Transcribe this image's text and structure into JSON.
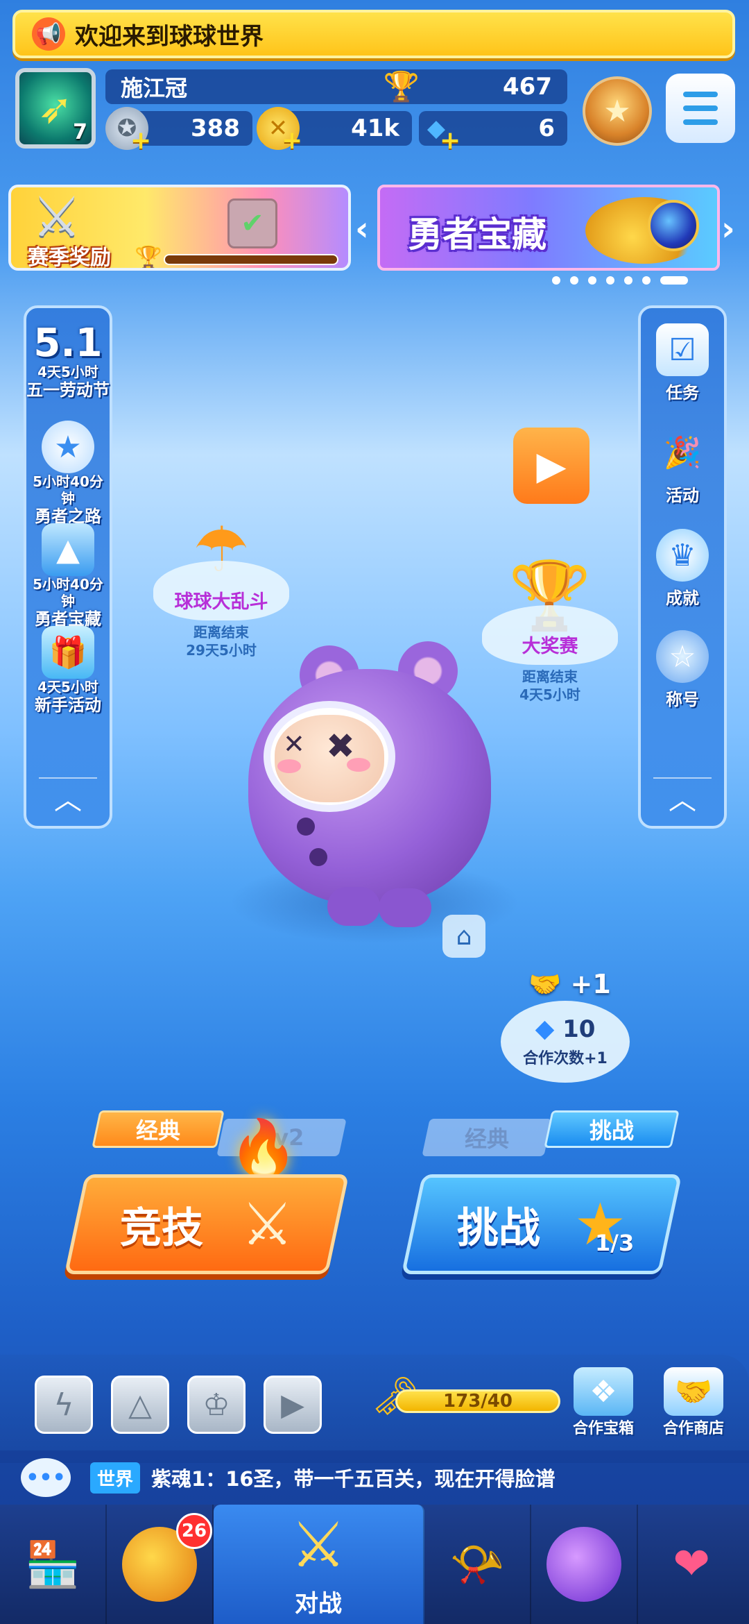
{
  "announcement": {
    "icon": "megaphone-icon",
    "text": "欢迎来到球球世界"
  },
  "player": {
    "name": "施江冠",
    "level": "7",
    "trophy_score": "467",
    "avatar_icon": "bow-emblem-icon"
  },
  "resources": [
    {
      "name": "stars",
      "icon": "star-coin-icon",
      "value": "388"
    },
    {
      "name": "coins",
      "icon": "gold-coin-icon",
      "value": "41k"
    },
    {
      "name": "diamonds",
      "icon": "diamond-icon",
      "value": "6"
    }
  ],
  "season_reward": {
    "label": "赛季奖励"
  },
  "promo": {
    "title": "勇者宝藏",
    "slides": 7,
    "active_slide": 7
  },
  "left_panel": [
    {
      "big": "5.1",
      "timer": "4天5小时",
      "label": "五一劳动节"
    },
    {
      "timer": "5小时40分钟",
      "label": "勇者之路"
    },
    {
      "timer": "5小时40分钟",
      "label": "勇者宝藏"
    },
    {
      "timer": "4天5小时",
      "label": "新手活动"
    }
  ],
  "right_panel": [
    {
      "icon": "checkbox-icon",
      "label": "任务"
    },
    {
      "icon": "party-popper-icon",
      "label": "活动"
    },
    {
      "icon": "crown-icon",
      "label": "成就"
    },
    {
      "icon": "star-badge-icon",
      "label": "称号"
    }
  ],
  "events": {
    "brawl": {
      "title": "球球大乱斗",
      "ends_label": "距离结束",
      "ends_value": "29天5小时"
    },
    "grand_prize": {
      "title": "大奖赛",
      "ends_label": "距离结束",
      "ends_value": "4天5小时"
    }
  },
  "coop": {
    "plus": "+1",
    "gems": "10",
    "count_label": "合作次数+1"
  },
  "modes": {
    "left_tabs": [
      "经典",
      "2v2"
    ],
    "right_tabs": [
      "经典",
      "挑战"
    ],
    "compete_label": "竞技",
    "challenge_label": "挑战",
    "challenge_progress": "1/3"
  },
  "dock": {
    "key_progress": "173/40",
    "coop_chest": "合作宝箱",
    "coop_shop": "合作商店"
  },
  "chat": {
    "channel": "世界",
    "message": "紫魂1：16圣，带一千五百关，现在开得脸谱"
  },
  "nav": {
    "active_label": "对战",
    "badge_count": "26"
  },
  "colors": {
    "accent_orange": "#ff8a1a",
    "accent_blue": "#1a8cf0",
    "gold": "#ffc21a"
  }
}
